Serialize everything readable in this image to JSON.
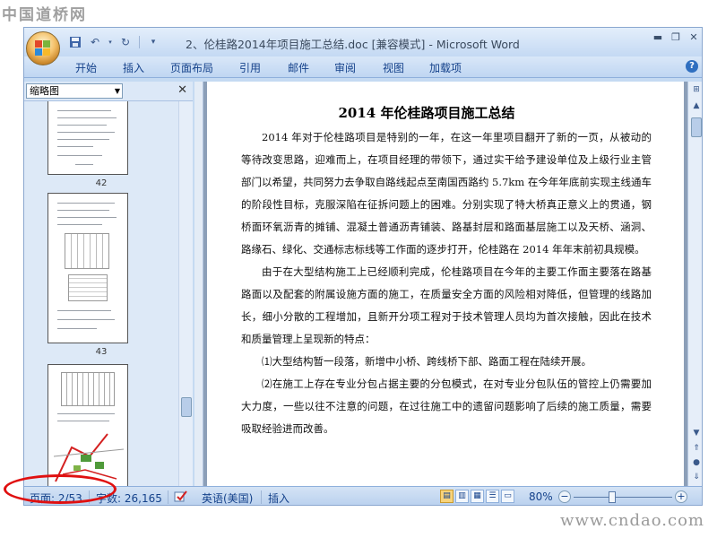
{
  "watermark_top": "中国道桥网",
  "watermark_bottom": "www.cndao.com",
  "window": {
    "title": "2、伦桂路2014年项目施工总结.doc [兼容模式] - Microsoft Word"
  },
  "ribbon_tabs": [
    "开始",
    "插入",
    "页面布局",
    "引用",
    "邮件",
    "审阅",
    "视图",
    "加载项"
  ],
  "thumbnail_pane": {
    "view_select": "缩略图",
    "page_numbers": [
      "42",
      "43"
    ]
  },
  "document": {
    "title": "2014 年伦桂路项目施工总结",
    "paragraphs": [
      "2014 年对于伦桂路项目是特别的一年，在这一年里项目翻开了新的一页，从被动的等待改变思路，迎难而上，在项目经理的带领下，通过实干给予建设单位及上级行业主管部门以希望，共同努力去争取自路线起点至南国西路约 5.7km 在今年年底前实现主线通车的阶段性目标，克服深陷在征拆问题上的困难。分别实现了特大桥真正意义上的贯通，钢桥面环氧沥青的摊铺、混凝土普通沥青铺装、路基封层和路面基层施工以及天桥、涵洞、路缘石、绿化、交通标志标线等工作面的逐步打开，伦桂路在 2014 年年末前初具规模。",
      "由于在大型结构施工上已经顺利完成，伦桂路项目在今年的主要工作面主要落在路基路面以及配套的附属设施方面的施工，在质量安全方面的风险相对降低，但管理的线路加长，细小分散的工程增加，且新开分项工程对于技术管理人员均为首次接触，因此在技术和质量管理上呈现新的特点：",
      "⑴大型结构暂一段落，新增中小桥、跨线桥下部、路面工程在陆续开展。",
      "⑵在施工上存在专业分包占据主要的分包模式，在对专业分包队伍的管控上仍需要加大力度，一些以往不注意的问题，在过往施工中的遗留问题影响了后续的施工质量，需要吸取经验进而改善。"
    ]
  },
  "status_bar": {
    "page": "页面: 2/53",
    "words": "字数: 26,165",
    "language": "英语(美国)",
    "mode": "插入",
    "zoom": "80%",
    "zoom_level_percent": 80
  },
  "highlight": {
    "color": "#e01010",
    "target": "status_bar.page"
  },
  "accent_colors": {
    "ribbon_text": "#15428b",
    "ribbon_bg": "#c5daf2"
  }
}
